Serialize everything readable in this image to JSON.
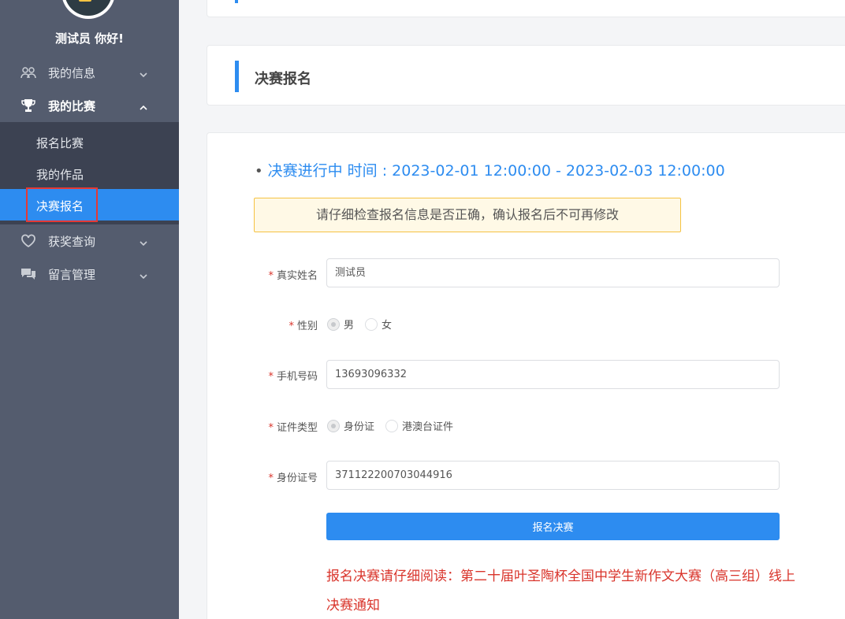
{
  "sidebar": {
    "greeting": "测试员 你好!",
    "menu": [
      {
        "label": "我的信息",
        "icon": "users-icon"
      },
      {
        "label": "我的比赛",
        "icon": "trophy-icon"
      },
      {
        "label": "获奖查询",
        "icon": "heart-icon"
      },
      {
        "label": "留言管理",
        "icon": "chat-icon"
      }
    ],
    "submenu": [
      {
        "label": "报名比赛"
      },
      {
        "label": "我的作品"
      },
      {
        "label": "决赛报名"
      }
    ]
  },
  "header": {
    "title": "决赛报名"
  },
  "main": {
    "status": "决赛进行中 时间 : 2023-02-01 12:00:00 - 2023-02-03 12:00:00",
    "bullet": "•",
    "notice": "请仔细检查报名信息是否正确，确认报名后不可再修改",
    "required_mark": "*",
    "form": {
      "name": {
        "label": "真实姓名",
        "value": "测试员"
      },
      "gender": {
        "label": "性别",
        "options": [
          "男",
          "女"
        ],
        "selected": "男"
      },
      "phone": {
        "label": "手机号码",
        "value": "13693096332"
      },
      "id_type": {
        "label": "证件类型",
        "options": [
          "身份证",
          "港澳台证件"
        ],
        "selected": "身份证"
      },
      "id_number": {
        "label": "身份证号",
        "value": "371122200703044916"
      }
    },
    "submit_label": "报名决赛",
    "read_notice": "报名决赛请仔细阅读：第二十届叶圣陶杯全国中学生新作文大赛（高三组）线上决赛通知"
  },
  "colors": {
    "sidebar_bg": "#545c6e",
    "submenu_bg": "#3c4252",
    "accent": "#2d8cf0",
    "danger": "#d9342b",
    "notice_bg": "#fff9e6",
    "notice_border": "#f5c242"
  }
}
